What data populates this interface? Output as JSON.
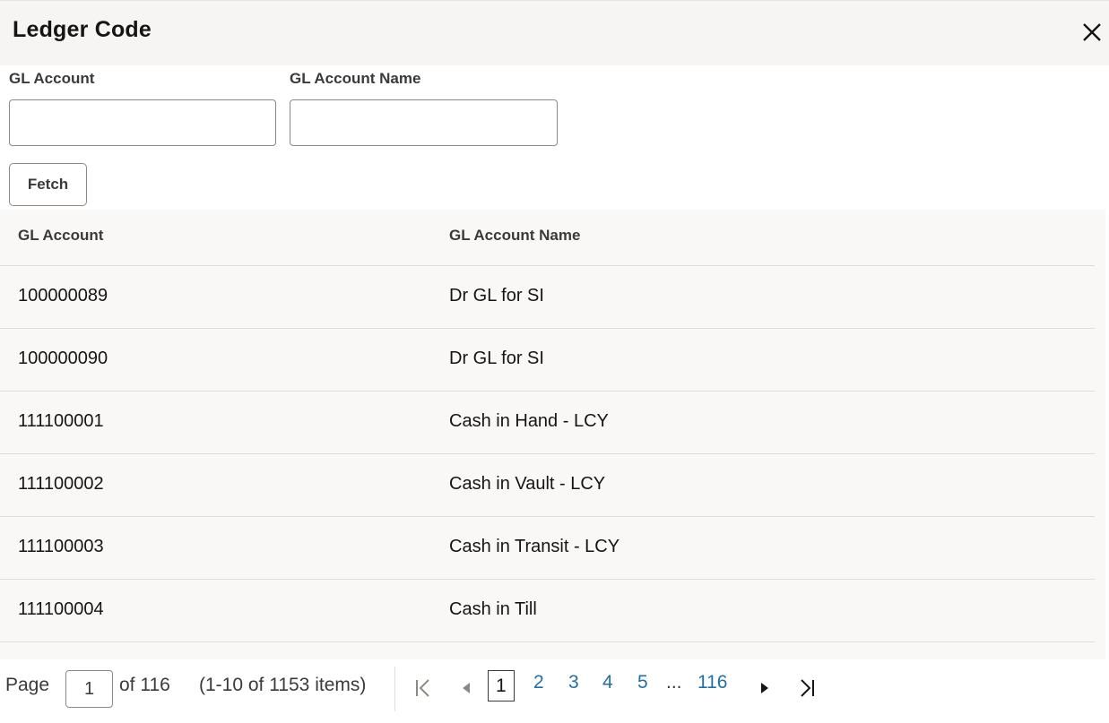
{
  "dialog": {
    "title": "Ledger Code",
    "close_icon": "close-icon"
  },
  "filters": {
    "gl_account_label": "GL Account",
    "gl_account_value": "",
    "gl_account_name_label": "GL Account Name",
    "gl_account_name_value": "",
    "fetch_label": "Fetch"
  },
  "table": {
    "columns": [
      "GL Account",
      "GL Account Name"
    ],
    "rows": [
      {
        "account": "100000089",
        "name": "Dr GL for SI"
      },
      {
        "account": "100000090",
        "name": "Dr GL for SI"
      },
      {
        "account": "111100001",
        "name": "Cash in Hand - LCY"
      },
      {
        "account": "111100002",
        "name": "Cash in Vault - LCY"
      },
      {
        "account": "111100003",
        "name": "Cash in Transit - LCY"
      },
      {
        "account": "111100004",
        "name": "Cash in Till"
      }
    ]
  },
  "pagination": {
    "page_label": "Page",
    "current_page": "1",
    "of_total": "of 116",
    "items_summary": "(1-10 of 1153 items)",
    "pages": [
      "1",
      "2",
      "3",
      "4",
      "5"
    ],
    "ellipsis": "...",
    "last_page": "116",
    "icons": {
      "first": "first-page-icon",
      "prev": "previous-page-icon",
      "next": "next-page-icon",
      "last": "last-page-icon"
    }
  }
}
